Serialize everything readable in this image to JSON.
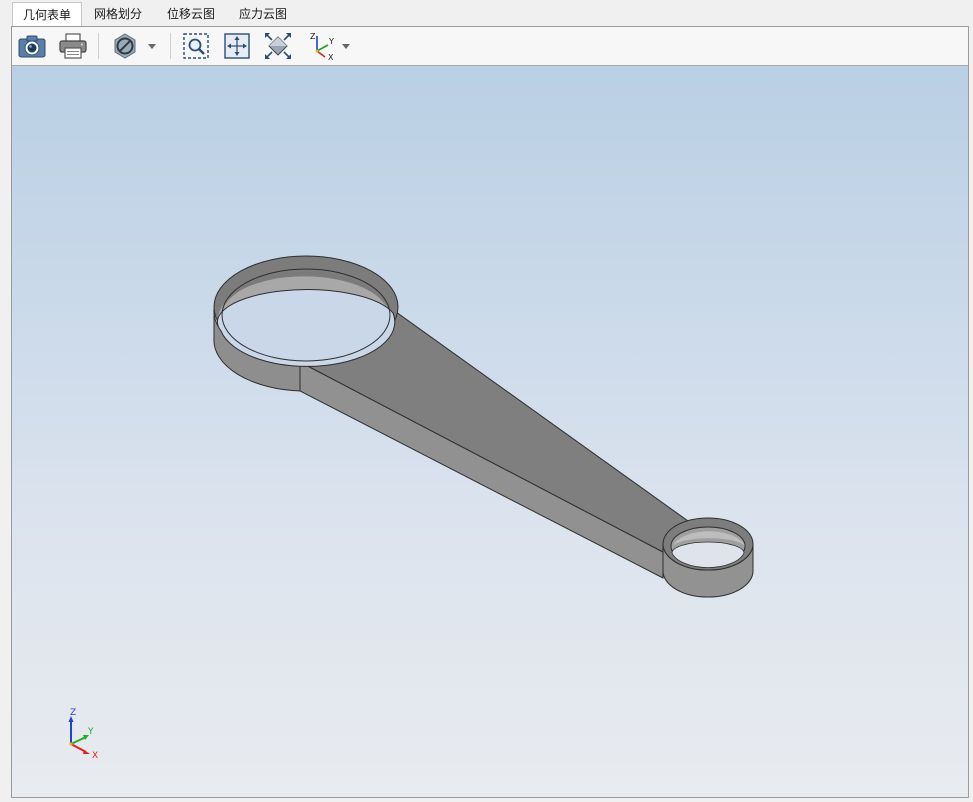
{
  "tabs": [
    {
      "label": "几何表单",
      "active": true
    },
    {
      "label": "网格划分",
      "active": false
    },
    {
      "label": "位移云图",
      "active": false
    },
    {
      "label": "应力云图",
      "active": false
    }
  ],
  "toolbar": {
    "icons": [
      "camera-icon",
      "print-icon",
      "no-display-icon",
      "zoom-box-icon",
      "fit-view-icon",
      "zoom-extents-icon",
      "axis-view-icon"
    ]
  },
  "triad": {
    "z": "Z",
    "y": "Y",
    "x": "X"
  },
  "colors": {
    "bg_top": "#b9cfe4",
    "bg_bottom": "#e8ebef",
    "part_top": "#7e7e7e",
    "part_side": "#8c8c8c",
    "axis_x": "#e02020",
    "axis_y": "#20b020",
    "axis_z": "#2040d0"
  }
}
